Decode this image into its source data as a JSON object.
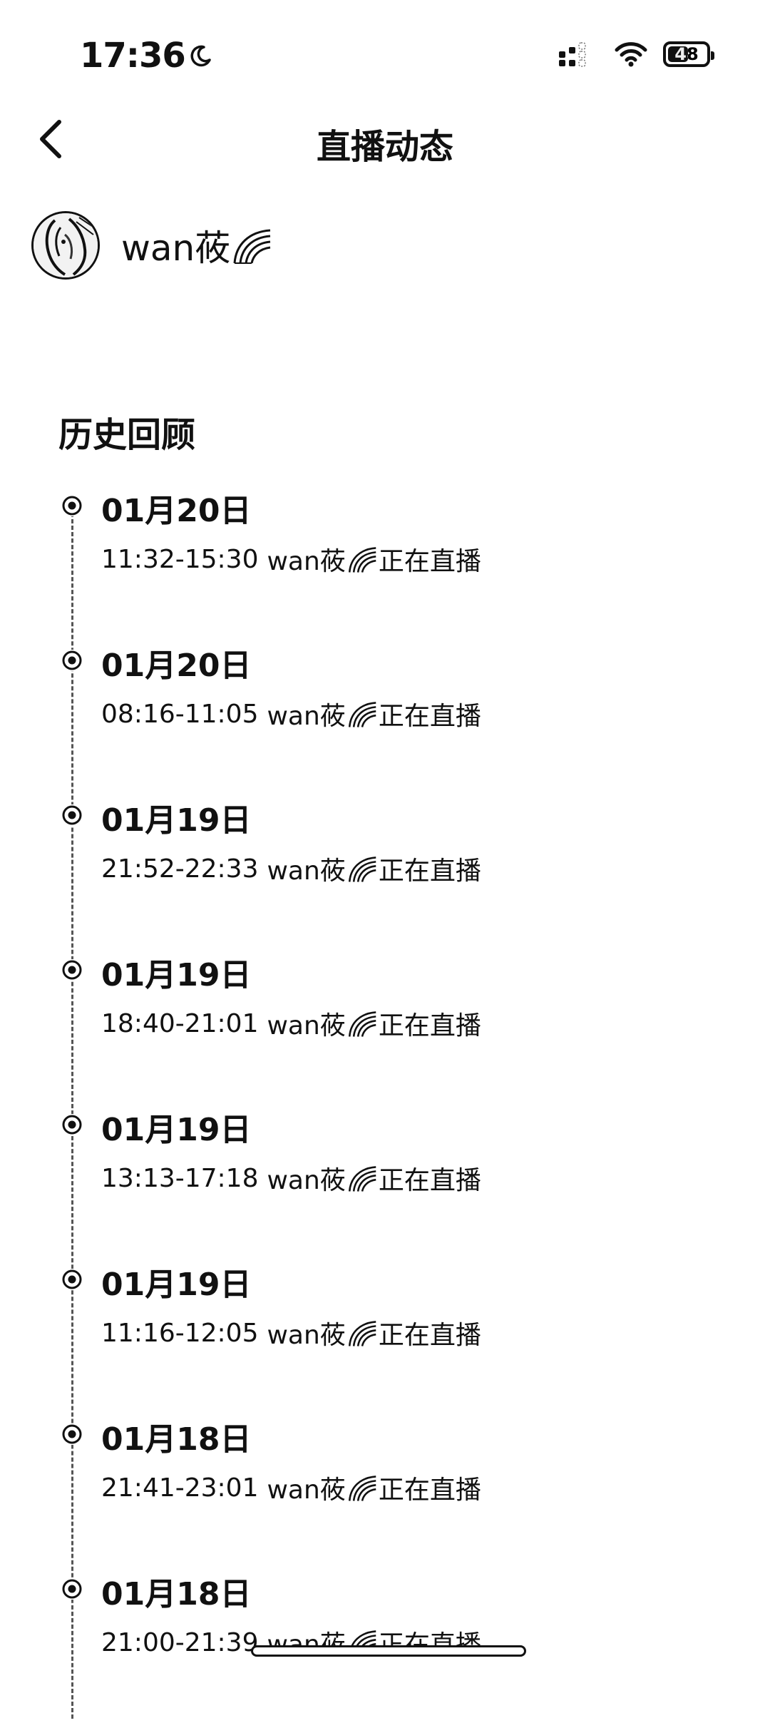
{
  "status_bar": {
    "time": "17:36",
    "battery_level": "48"
  },
  "nav": {
    "title": "直播动态"
  },
  "profile": {
    "name": "wan莜"
  },
  "history": {
    "section_title": "历史回顾",
    "items": [
      {
        "date": "01月20日",
        "time_range": "11:32-15:30",
        "name": "wan莜",
        "status": "正在直播"
      },
      {
        "date": "01月20日",
        "time_range": "08:16-11:05",
        "name": "wan莜",
        "status": "正在直播"
      },
      {
        "date": "01月19日",
        "time_range": "21:52-22:33",
        "name": "wan莜",
        "status": "正在直播"
      },
      {
        "date": "01月19日",
        "time_range": "18:40-21:01",
        "name": "wan莜",
        "status": "正在直播"
      },
      {
        "date": "01月19日",
        "time_range": "13:13-17:18",
        "name": "wan莜",
        "status": "正在直播"
      },
      {
        "date": "01月19日",
        "time_range": "11:16-12:05",
        "name": "wan莜",
        "status": "正在直播"
      },
      {
        "date": "01月18日",
        "time_range": "21:41-23:01",
        "name": "wan莜",
        "status": "正在直播"
      },
      {
        "date": "01月18日",
        "time_range": "21:00-21:39",
        "name": "wan莜",
        "status": "正在直播"
      }
    ]
  }
}
